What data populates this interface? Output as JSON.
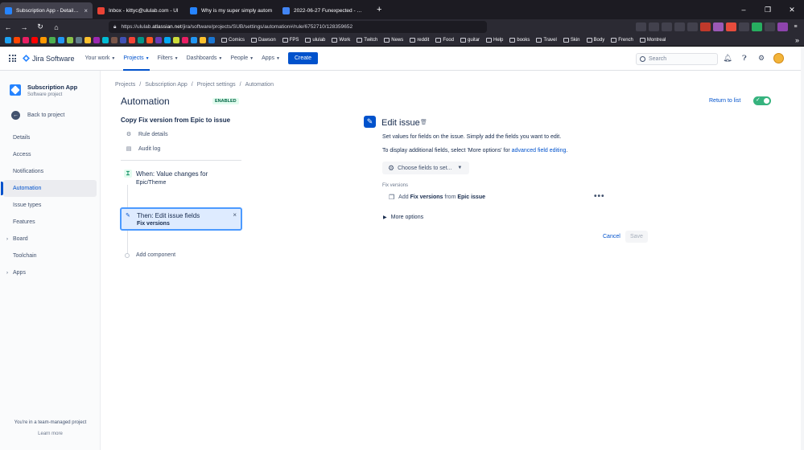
{
  "browser": {
    "tabs": [
      {
        "title": "Subscription App - Details - JIRA",
        "active": true,
        "icon_color": "#2684ff"
      },
      {
        "title": "Inbox - kittyc@ululab.com - Ul",
        "active": false,
        "icon_color": "#ea4335"
      },
      {
        "title": "Why is my super simply autom",
        "active": false,
        "icon_color": "#2684ff"
      },
      {
        "title": "2022-06-27 Funexpected - Goo",
        "active": false,
        "icon_color": "#4285f4"
      }
    ],
    "new_tab": "+",
    "url_prefix": "https://ululab.",
    "url_host": "atlassian.net",
    "url_path": "/jira/software/projects/SUB/settings/automation#/rule/6752710/128359652",
    "bookmark_folders": [
      "Comics",
      "Dawson",
      "FPS",
      "ululab",
      "Work",
      "Twitch",
      "News",
      "reddit",
      "Food",
      "guitar",
      "Help",
      "books",
      "Travel",
      "Skin",
      "Body",
      "French",
      "Montreal"
    ],
    "bookmark_overflow": "»"
  },
  "topnav": {
    "product": "Jira Software",
    "menu": [
      {
        "label": "Your work",
        "active": false
      },
      {
        "label": "Projects",
        "active": true
      },
      {
        "label": "Filters",
        "active": false
      },
      {
        "label": "Dashboards",
        "active": false
      },
      {
        "label": "People",
        "active": false
      },
      {
        "label": "Apps",
        "active": false
      }
    ],
    "create_label": "Create",
    "search_placeholder": "Search"
  },
  "sidebar": {
    "project_name": "Subscription App",
    "project_type": "Software project",
    "back_label": "Back to project",
    "items": [
      {
        "label": "Details",
        "active": false,
        "expandable": false
      },
      {
        "label": "Access",
        "active": false,
        "expandable": false
      },
      {
        "label": "Notifications",
        "active": false,
        "expandable": false
      },
      {
        "label": "Automation",
        "active": true,
        "expandable": false
      },
      {
        "label": "Issue types",
        "active": false,
        "expandable": false
      },
      {
        "label": "Features",
        "active": false,
        "expandable": false
      },
      {
        "label": "Board",
        "active": false,
        "expandable": true
      },
      {
        "label": "Toolchain",
        "active": false,
        "expandable": false
      },
      {
        "label": "Apps",
        "active": false,
        "expandable": true
      }
    ],
    "footer_text": "You're in a team-managed project",
    "footer_link": "Learn more"
  },
  "main": {
    "breadcrumb": [
      "Projects",
      "Subscription App",
      "Project settings",
      "Automation"
    ],
    "breadcrumb_sep": "/",
    "title": "Automation",
    "status_badge": "ENABLED",
    "return_link": "Return to list",
    "rule_name": "Copy Fix version from Epic to issue",
    "rule_details": "Rule details",
    "audit_log": "Audit log",
    "trigger_label": "When: Value changes for",
    "trigger_field": "Epic/Theme",
    "action_label": "Then: Edit issue fields",
    "action_field": "Fix versions",
    "add_component": "Add component"
  },
  "edit_panel": {
    "title": "Edit issue",
    "desc1": "Set values for fields on the issue. Simply add the fields you want to edit.",
    "desc2_prefix": "To display additional fields, select 'More options' for",
    "desc2_link": "advanced field editing",
    "desc2_suffix": ".",
    "choose_fields": "Choose fields to set...",
    "field_label": "Fix versions",
    "field_row_add": "Add",
    "field_row_field": "Fix versions",
    "field_row_from": "from",
    "field_row_source": "Epic issue",
    "more_options": "More options",
    "cancel": "Cancel",
    "save": "Save"
  },
  "colors": {
    "accent": "#0052cc",
    "toggle_on": "#36b37e",
    "enabled_badge": "#006644"
  }
}
